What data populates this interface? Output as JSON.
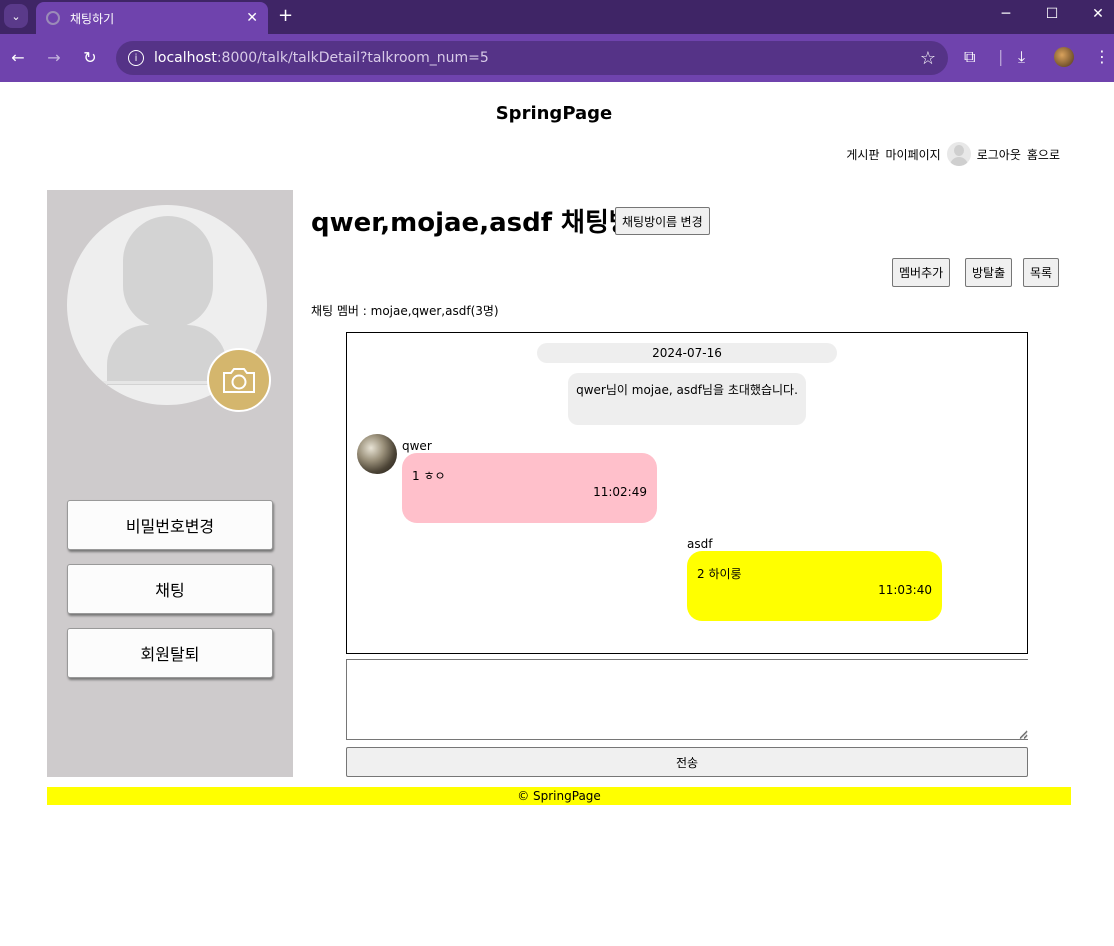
{
  "browser": {
    "tab_title": "채팅하기",
    "url_host": "localhost",
    "url_path": ":8000/talk/talkDetail?talkroom_num=5"
  },
  "page": {
    "site_title": "SpringPage",
    "nav": {
      "board": "게시판",
      "mypage": "마이페이지",
      "logout": "로그아웃",
      "home": "홈으로"
    }
  },
  "sidebar": {
    "buttons": [
      "비밀번호변경",
      "채팅",
      "회원탈퇴"
    ]
  },
  "room": {
    "title": "qwer,mojae,asdf  채팅방",
    "rename_label": "채팅방이름 변경",
    "actions": [
      "멤버추가",
      "방탈출",
      "목록"
    ],
    "members_text": "채팅 멤버 : mojae,qwer,asdf(3명)"
  },
  "chat": {
    "date": "2024-07-16",
    "notice": "qwer님이 mojae, asdf님을 초대했습니다.",
    "messages": [
      {
        "sender": "qwer",
        "unread": "1",
        "text": "ㅎㅇ",
        "time": "11:02:49"
      },
      {
        "sender": "asdf",
        "unread": "2",
        "text": "하이룽",
        "time": "11:03:40"
      }
    ]
  },
  "composer": {
    "send_label": "전송"
  },
  "footer": {
    "text": "© SpringPage"
  },
  "colors": {
    "chrome_dark": "#3f2566",
    "chrome": "#6f43ad",
    "sidebar_bg": "#cecbcc",
    "camera": "#d4b66d",
    "bubble_other": "#ffc0cb",
    "bubble_other2": "#ffff00",
    "footer_bg": "#ffff00"
  }
}
